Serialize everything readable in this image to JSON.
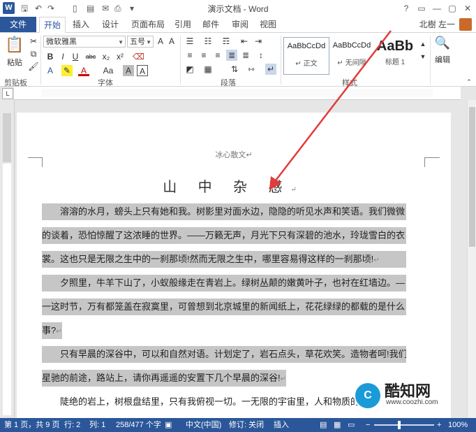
{
  "window": {
    "title": "演示文档 - Word",
    "controls": [
      "?",
      "▭",
      "—",
      "▢",
      "✕"
    ]
  },
  "quick_access": [
    "save-icon",
    "undo-icon",
    "redo-icon",
    "new-icon",
    "open-icon",
    "email-icon",
    "print-icon"
  ],
  "tabs": {
    "file": "文件",
    "items": [
      "开始",
      "插入",
      "设计",
      "页面布局",
      "引用",
      "邮件",
      "审阅",
      "视图"
    ],
    "active": "开始"
  },
  "user": {
    "name": "北樹 左一",
    "avatar_color": "#c96a2a"
  },
  "ribbon": {
    "clipboard": {
      "paste": "粘贴",
      "label": "剪贴板"
    },
    "font": {
      "name": "微软雅黑",
      "size": "五号",
      "label": "字体",
      "buttons": [
        "B",
        "I",
        "U",
        "abc",
        "x₂",
        "x²",
        "A",
        "A",
        "Aa",
        "A",
        "A"
      ]
    },
    "paragraph": {
      "label": "段落"
    },
    "styles": {
      "label": "样式",
      "items": [
        {
          "sample": "AaBbCcDd",
          "name": "↵ 正文"
        },
        {
          "sample": "AaBbCcDd",
          "name": "↵ 无间隔"
        },
        {
          "sample": "AaBb",
          "name": "标题 1"
        }
      ]
    },
    "editing": {
      "label": "编辑"
    }
  },
  "document": {
    "header": "冰心散文↵",
    "heading": "山 中 杂 感",
    "heading_mark": "↵",
    "lines": [
      {
        "text": "溶溶的水月，螃头上只有她和我。树影里对面水边，隐隐的听见水声和笑语。我们微微",
        "highlight": true,
        "indent": true
      },
      {
        "text": "的谈着，恐怕惊醒了这浓睡的世界。——万籁无声，月光下只有深碧的池水，玲珑雪白的衣",
        "highlight": true,
        "indent": false
      },
      {
        "text": "裳。这也只是无限之生中的一刹那顷!然而无限之生中，哪里容易得这样的一刹那顷!",
        "highlight": true,
        "indent": false,
        "mark": "↵"
      },
      {
        "text": "夕照里，牛羊下山了，小蚁般缘走在青岩上。绿树丛颠的嫩黄叶子，也衬在红墙边。—",
        "highlight": true,
        "indent": true
      },
      {
        "text": "一这时节，万有都笼盖在寂寞里，可曾想到北京城里的新闻纸上，花花绿绿的都载的是什么",
        "highlight": true,
        "indent": false
      },
      {
        "text": "事?",
        "highlight": true,
        "indent": false,
        "mark": "↵"
      },
      {
        "text": "只有早晨的深谷中，可以和自然对语。计划定了，岩石点头，草花欢笑。造物者呵!我们",
        "highlight": true,
        "indent": true
      },
      {
        "text": "星驰的前途，路站上，请你再遥遥的安置下几个早晨的深谷!",
        "highlight": true,
        "indent": false,
        "mark": "↵"
      },
      {
        "text": "陡绝的岩上，树根盘结里，只有我俯视一切。一无限的宇宙里，人和物质的山",
        "highlight": false,
        "indent": true
      }
    ]
  },
  "watermark": {
    "logo": "C",
    "name": "酷知网",
    "url": "www.coozhi.com"
  },
  "status": {
    "page": "第 1 页，共 9 页",
    "line": "行: 2",
    "column": "列: 1",
    "words": "258/477 个字",
    "language": "中文(中国)",
    "track": "修订: 关闭",
    "mode": "插入",
    "zoom_minus": "−",
    "zoom_plus": "+",
    "zoom": "100%",
    "zoom_level": 1.0
  },
  "colors": {
    "accent": "#2b579a",
    "highlight": "#c6c6c6",
    "arrow": "#e23b3b"
  }
}
